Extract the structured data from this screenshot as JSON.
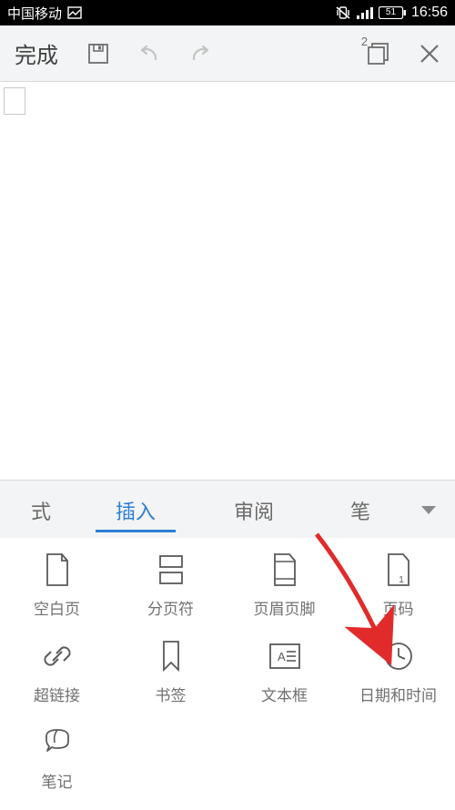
{
  "status": {
    "carrier": "中国移动",
    "battery": "51",
    "time": "16:56"
  },
  "toolbar": {
    "done": "完成",
    "page_indicator": "2"
  },
  "tabs": {
    "t0": "式",
    "t1": "插入",
    "t2": "审阅",
    "t3": "笔"
  },
  "insert": {
    "blank_page": "空白页",
    "page_break": "分页符",
    "header_footer": "页眉页脚",
    "page_number": "页码",
    "hyperlink": "超链接",
    "bookmark": "书签",
    "text_box": "文本框",
    "date_time": "日期和时间",
    "note": "笔记"
  }
}
